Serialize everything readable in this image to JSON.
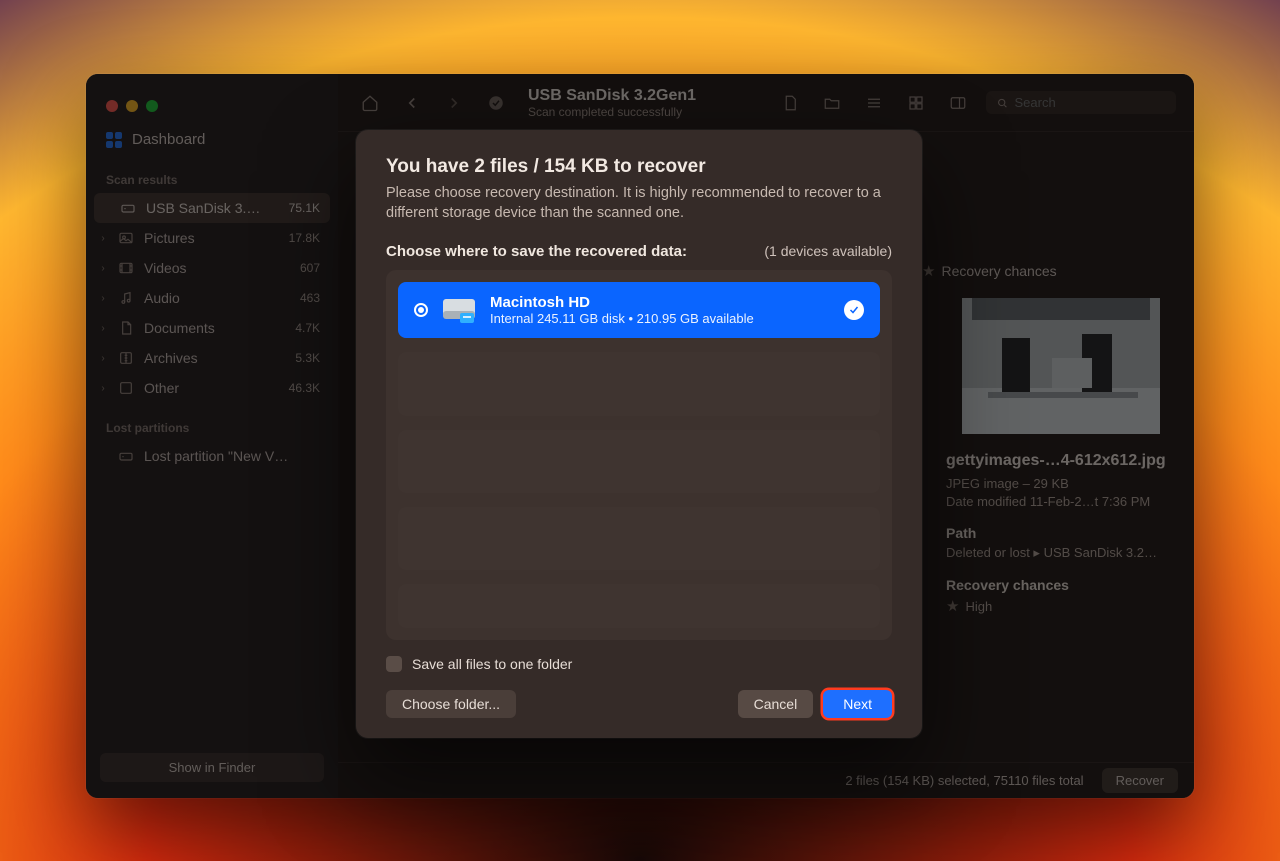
{
  "sidebar": {
    "dashboard_label": "Dashboard",
    "scan_results_header": "Scan results",
    "lost_partitions_header": "Lost partitions",
    "lost_partition_label": "Lost partition \"New V…",
    "items": [
      {
        "label": "USB  SanDisk 3.…",
        "count": "75.1K"
      },
      {
        "label": "Pictures",
        "count": "17.8K"
      },
      {
        "label": "Videos",
        "count": "607"
      },
      {
        "label": "Audio",
        "count": "463"
      },
      {
        "label": "Documents",
        "count": "4.7K"
      },
      {
        "label": "Archives",
        "count": "5.3K"
      },
      {
        "label": "Other",
        "count": "46.3K"
      }
    ],
    "show_in_finder": "Show in Finder"
  },
  "toolbar": {
    "title": "USB  SanDisk 3.2Gen1",
    "subtitle": "Scan completed successfully",
    "search_placeholder": "Search",
    "recovery_chances_label": "Recovery chances"
  },
  "details": {
    "filename": "gettyimages-…4-612x612.jpg",
    "meta_type": "JPEG image – 29 KB",
    "meta_date": "Date modified  11-Feb-2…t 7:36 PM",
    "path_header": "Path",
    "path_value": "Deleted or lost ▸ USB  SanDisk 3.2…",
    "rc_header": "Recovery chances",
    "rc_value": "High"
  },
  "statusbar": {
    "text": "2 files (154 KB) selected, 75110 files total",
    "recover_btn": "Recover"
  },
  "modal": {
    "title": "You have 2 files / 154 KB to recover",
    "desc": "Please choose recovery destination. It is highly recommended to recover to a different storage device than the scanned one.",
    "choose_label": "Choose where to save the recovered data:",
    "devices_available": "(1 devices available)",
    "dest": {
      "name": "Macintosh HD",
      "info": "Internal 245.11 GB disk • 210.95 GB available"
    },
    "save_all_label": "Save all files to one folder",
    "choose_folder_btn": "Choose folder...",
    "cancel_btn": "Cancel",
    "next_btn": "Next"
  }
}
